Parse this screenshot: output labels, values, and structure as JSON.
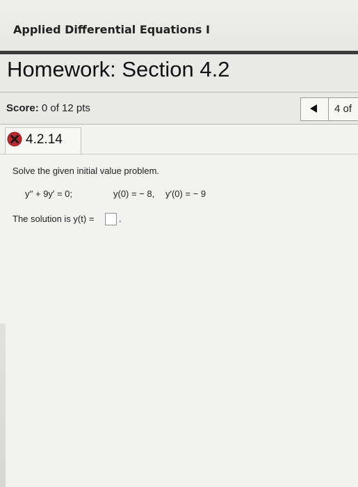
{
  "course": {
    "title": "Applied Differential Equations I"
  },
  "homework": {
    "title": "Homework: Section 4.2"
  },
  "score": {
    "label": "Score:",
    "value": "0 of 12 pts"
  },
  "navigation": {
    "prev_icon": "triangle-left-icon",
    "question_count": "4 of"
  },
  "problem": {
    "status_icon": "red-x-circle-icon",
    "number": "4.2.14",
    "instruction": "Solve the given initial value problem.",
    "equation": "y′′ + 9y′ = 0;",
    "initial_condition_1": "y(0) = − 8,",
    "initial_condition_2": "y′(0) = − 9",
    "solution_prompt": "The solution is y(t) =",
    "answer_value": "",
    "answer_suffix": "."
  },
  "colors": {
    "incorrect": "#c0262d",
    "header_rule": "#3a3a3a",
    "panel": "#f2f2f0"
  }
}
